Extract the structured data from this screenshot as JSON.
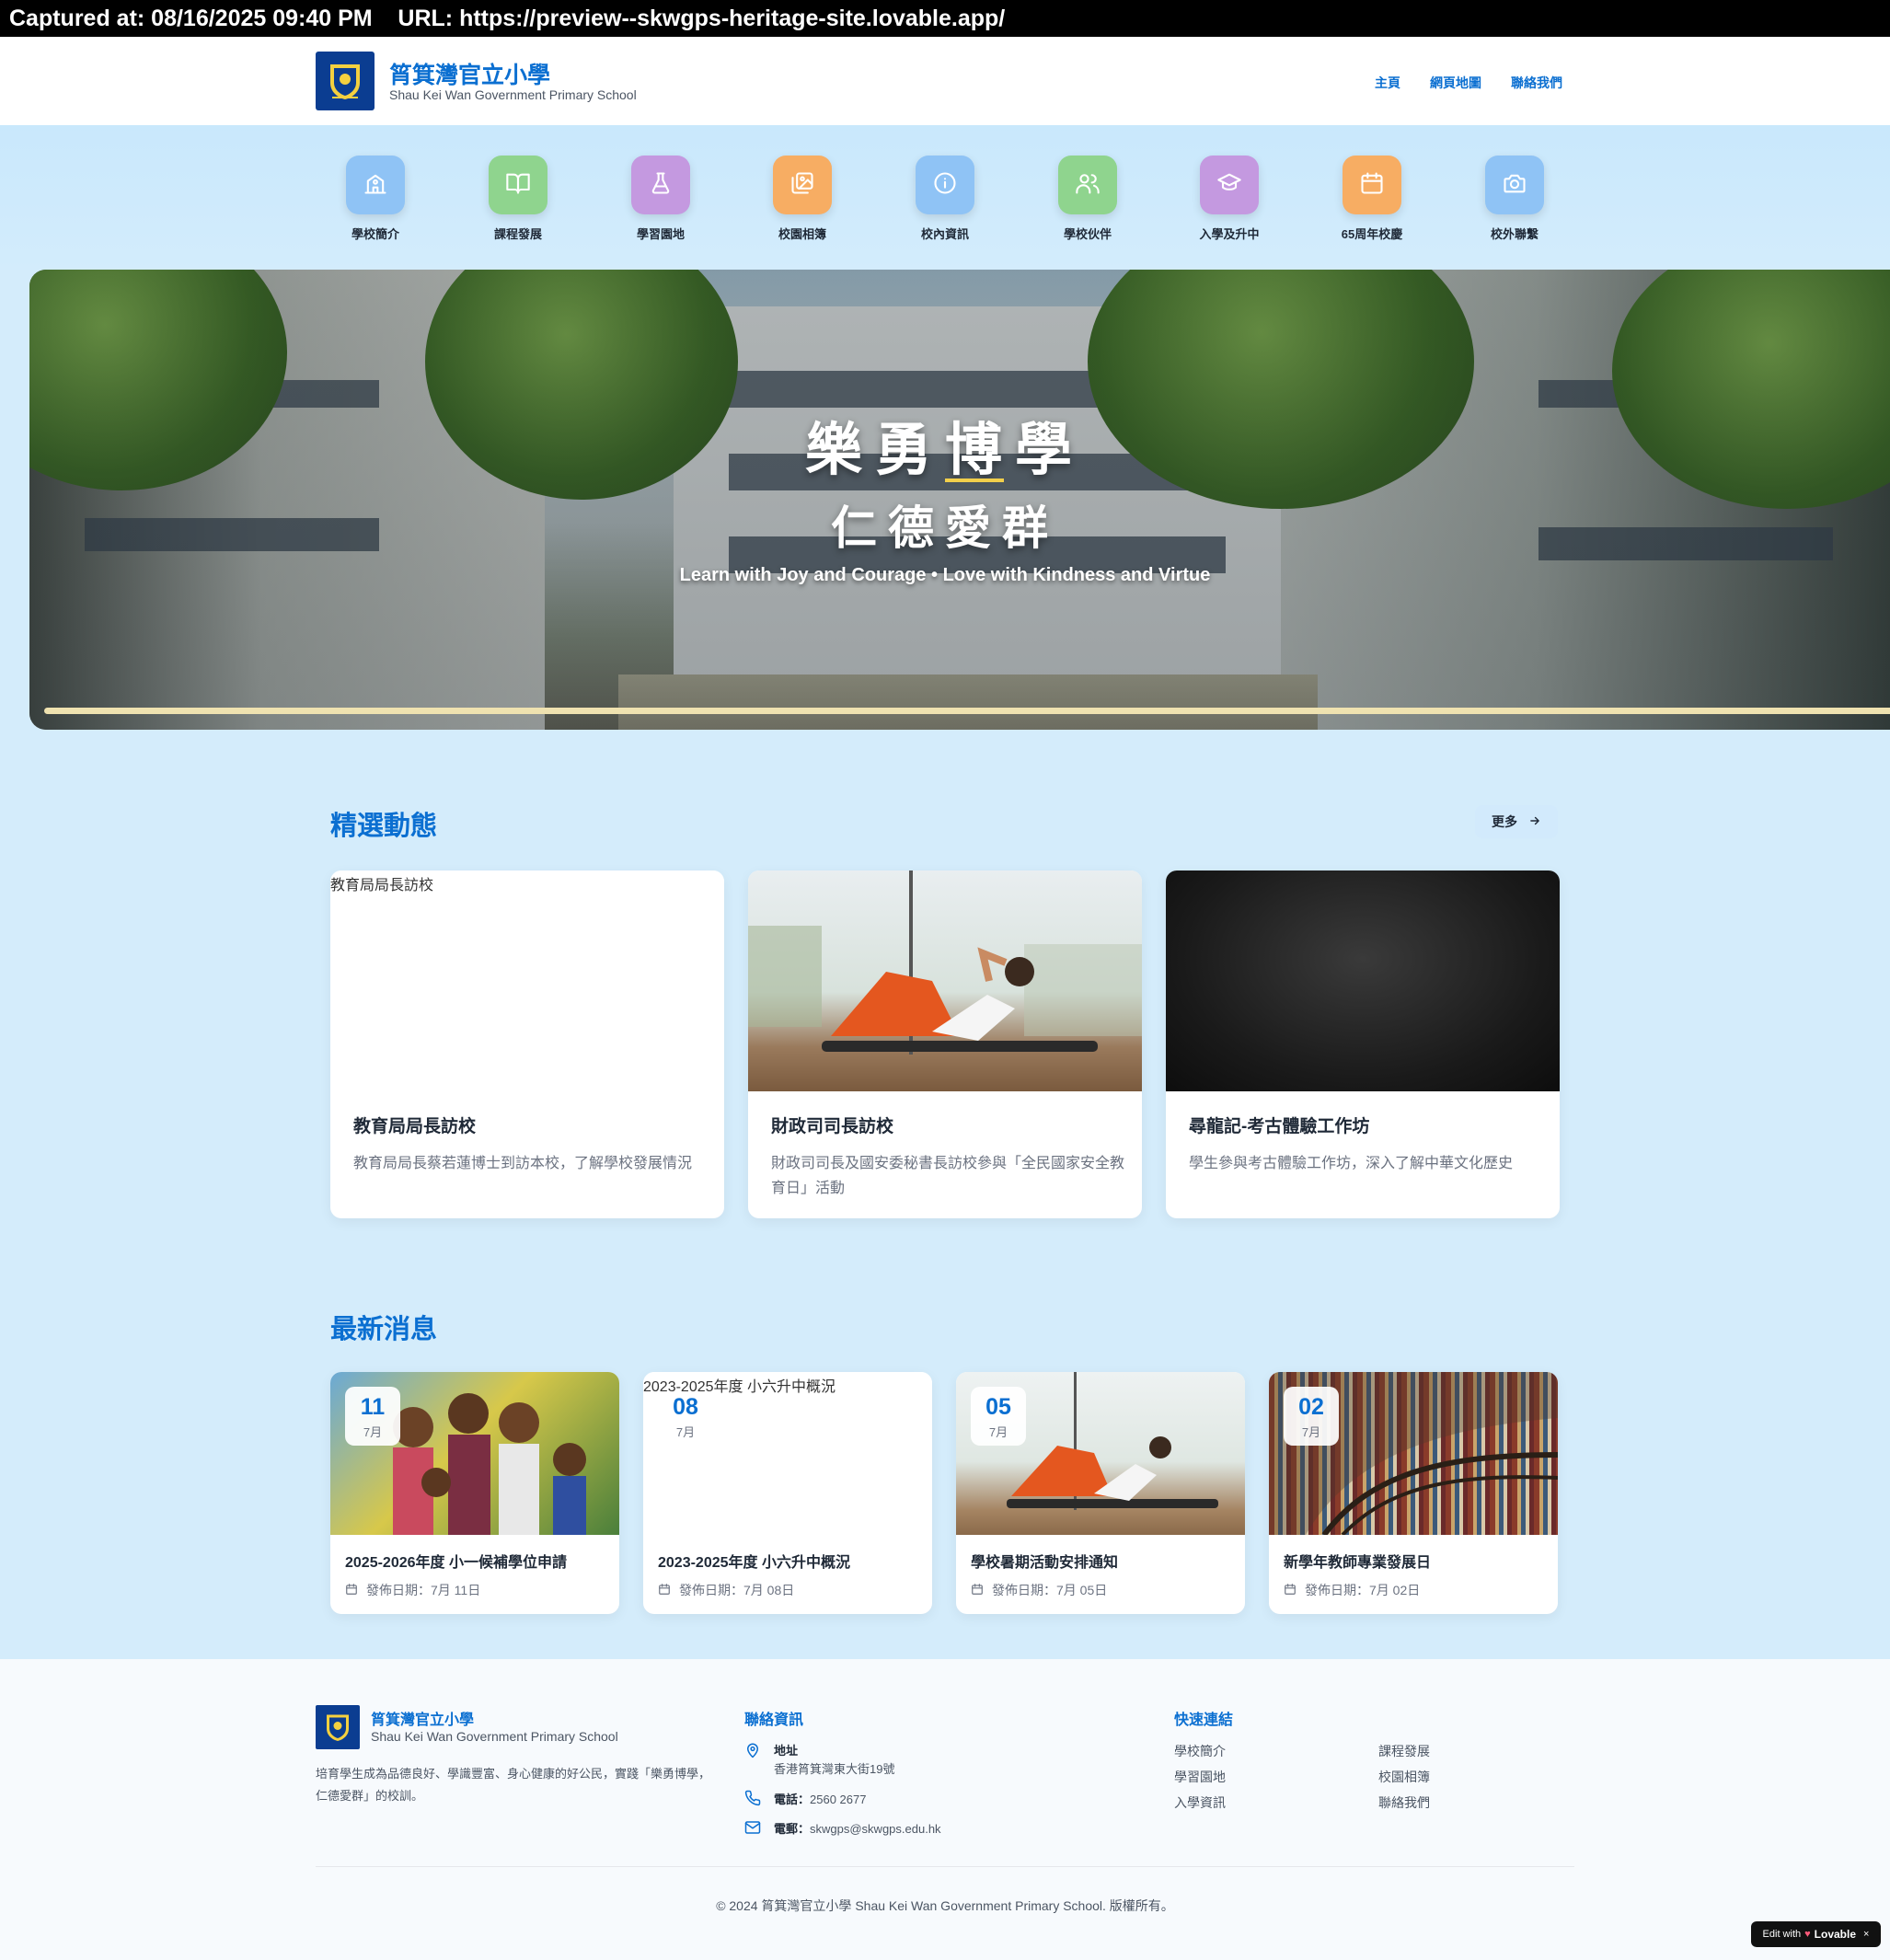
{
  "capture": {
    "text": "Captured at: 08/16/2025 09:40 PM    URL: https://preview--skwgps-heritage-site.lovable.app/"
  },
  "header": {
    "name_zh": "筲箕灣官立小學",
    "name_en": "Shau Kei Wan Government Primary School",
    "nav": [
      "主頁",
      "網頁地圖",
      "聯絡我們"
    ]
  },
  "quick_links": [
    {
      "label": "學校簡介",
      "icon": "school-building-icon",
      "color": "#8fc3f5"
    },
    {
      "label": "課程發展",
      "icon": "open-book-icon",
      "color": "#8fd48e"
    },
    {
      "label": "學習園地",
      "icon": "flask-icon",
      "color": "#c499e0"
    },
    {
      "label": "校園相簿",
      "icon": "photo-gallery-icon",
      "color": "#f7ad63"
    },
    {
      "label": "校內資訊",
      "icon": "info-icon",
      "color": "#8fc3f5"
    },
    {
      "label": "學校伙伴",
      "icon": "users-icon",
      "color": "#8fd48e"
    },
    {
      "label": "入學及升中",
      "icon": "graduation-cap-icon",
      "color": "#c499e0"
    },
    {
      "label": "65周年校慶",
      "icon": "calendar-icon",
      "color": "#f7ad63"
    },
    {
      "label": "校外聯繫",
      "icon": "camera-icon",
      "color": "#8fc3f5"
    }
  ],
  "hero": {
    "title": "樂勇博學",
    "subtitle": "仁德愛群",
    "tagline": "Learn with Joy and Courage • Love with Kindness and Virtue"
  },
  "featured": {
    "title": "精選動態",
    "more": "更多",
    "items": [
      {
        "alt": "教育局局長訪校",
        "title": "教育局局長訪校",
        "desc": "教育局局長蔡若蓮博士到訪本校，了解學校發展情況"
      },
      {
        "title": "財政司司長訪校",
        "desc": "財政司司長及國安委秘書長訪校參與「全民國家安全教育日」活動"
      },
      {
        "title": "尋龍記-考古體驗工作坊",
        "desc": "學生參與考古體驗工作坊，深入了解中華文化歷史"
      }
    ]
  },
  "news": {
    "title": "最新消息",
    "date_prefix": "發佈日期：",
    "items": [
      {
        "day": "11",
        "month": "7月",
        "title": "2025-2026年度 小一候補學位申請",
        "date": "7月 11日"
      },
      {
        "day": "08",
        "month": "7月",
        "alt": "2023-2025年度 小六升中概況",
        "title": "2023-2025年度 小六升中概況",
        "date": "7月 08日"
      },
      {
        "day": "05",
        "month": "7月",
        "title": "學校暑期活動安排通知",
        "date": "7月 05日"
      },
      {
        "day": "02",
        "month": "7月",
        "title": "新學年教師專業發展日",
        "date": "7月 02日"
      }
    ]
  },
  "footer": {
    "name_zh": "筲箕灣官立小學",
    "name_en": "Shau Kei Wan Government Primary School",
    "desc": "培育學生成為品德良好、學識豐富、身心健康的好公民，實踐「樂勇博學，仁德愛群」的校訓。",
    "contact_title": "聯絡資訊",
    "address_label": "地址",
    "address": "香港筲箕灣東大街19號",
    "phone_label": "電話：",
    "phone": "2560 2677",
    "email_label": "電郵：",
    "email": "skwgps@skwgps.edu.hk",
    "links_title": "快速連結",
    "links": [
      "學校簡介",
      "課程發展",
      "學習園地",
      "校園相簿",
      "入學資訊",
      "聯絡我們"
    ],
    "copyright": "© 2024 筲箕灣官立小學 Shau Kei Wan Government Primary School. 版權所有。"
  },
  "badge": {
    "prefix": "Edit with",
    "brand": "Lovable",
    "close": "×"
  }
}
